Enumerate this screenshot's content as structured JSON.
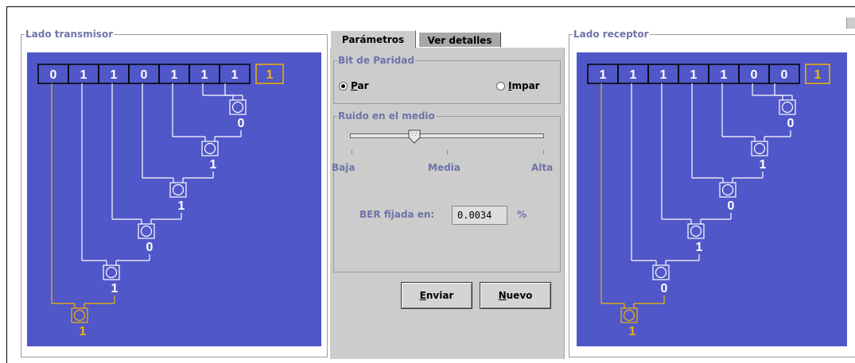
{
  "transmitter": {
    "legend": "Lado transmisor",
    "bits": [
      "0",
      "1",
      "1",
      "0",
      "1",
      "1",
      "1"
    ],
    "parity_bit": "1",
    "xor_outputs": [
      "0",
      "1",
      "1",
      "0",
      "1",
      "1"
    ],
    "final_output": "1"
  },
  "receiver": {
    "legend": "Lado receptor",
    "bits": [
      "1",
      "1",
      "1",
      "1",
      "1",
      "0",
      "0"
    ],
    "parity_bit": "1",
    "xor_outputs": [
      "0",
      "1",
      "0",
      "1",
      "0",
      "1"
    ],
    "final_output": "1"
  },
  "tabs": [
    {
      "label": "Parámetros",
      "active": true
    },
    {
      "label": "Ver detalles",
      "active": false
    }
  ],
  "parity": {
    "legend": "Bit de Paridad",
    "options": [
      {
        "label": "Par",
        "mnemonic": "P",
        "rest": "ar",
        "selected": true
      },
      {
        "label": "Impar",
        "mnemonic": "I",
        "rest": "mpar",
        "selected": false
      }
    ]
  },
  "noise": {
    "legend": "Ruido en el medio",
    "labels": [
      "Baja",
      "Media",
      "Alta"
    ],
    "level_fraction": 0.33
  },
  "ber": {
    "label": "BER fijada en:",
    "value": "0.0034",
    "unit": "%"
  },
  "buttons": {
    "send": {
      "mnemonic": "E",
      "rest": "nviar"
    },
    "new": {
      "mnemonic": "N",
      "rest": "uevo"
    }
  },
  "colors": {
    "board": "#5057c8",
    "highlight": "#f0b400",
    "line": "#ffffff"
  }
}
